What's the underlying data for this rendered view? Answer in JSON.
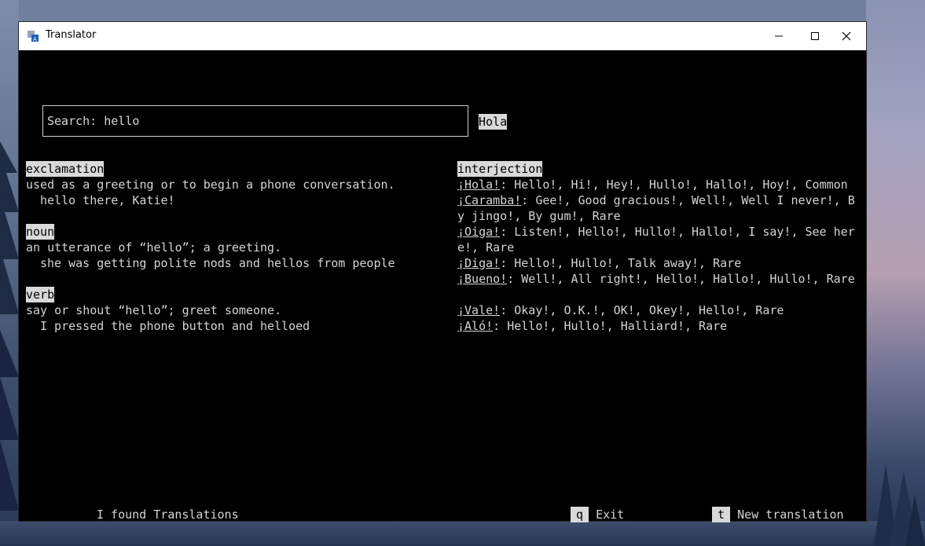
{
  "window": {
    "title": "Translator"
  },
  "search": {
    "label": "Search: ",
    "value": "hello",
    "translation": "Hola"
  },
  "definitions": [
    {
      "pos": "exclamation",
      "meaning": "used as a greeting or to begin a phone conversation.",
      "example": "hello there, Katie!"
    },
    {
      "pos": "noun",
      "meaning": "an utterance of “hello”; a greeting.",
      "example": "she was getting polite nods and hellos from people"
    },
    {
      "pos": "verb",
      "meaning": "say or shout “hello”; greet someone.",
      "example": "I pressed the phone button and helloed"
    }
  ],
  "translations": {
    "pos": "interjection",
    "entries": [
      {
        "word": "¡Hola!",
        "rest": ": Hello!, Hi!, Hey!, Hullo!, Hallo!, Hoy!, Common"
      },
      {
        "word": "¡Caramba!",
        "rest": ": Gee!, Good gracious!, Well!, Well I never!, B",
        "cont": "y jingo!, By gum!, Rare"
      },
      {
        "word": "¡Oiga!",
        "rest": ": Listen!, Hello!, Hullo!, Hallo!, I say!, See her",
        "cont": "e!, Rare"
      },
      {
        "word": "¡Diga!",
        "rest": ": Hello!, Hullo!, Talk away!, Rare"
      },
      {
        "word": "¡Bueno!",
        "rest": ": Well!, All right!, Hello!, Hallo!, Hullo!, Rare"
      },
      {
        "word": "¡Vale!",
        "rest": ": Okay!, O.K.!, OK!, Okey!, Hello!, Rare"
      },
      {
        "word": "¡Aló!",
        "rest": ": Hello!, Hullo!, Halliard!, Rare"
      }
    ]
  },
  "footer": {
    "status": "I found Translations",
    "exit_key": "q",
    "exit_label": "Exit",
    "new_key": "t",
    "new_label": "New translation"
  },
  "colors": {
    "terminal_bg": "#000000",
    "text": "#d4d4d4",
    "highlight_bg": "#d9d9d9"
  }
}
